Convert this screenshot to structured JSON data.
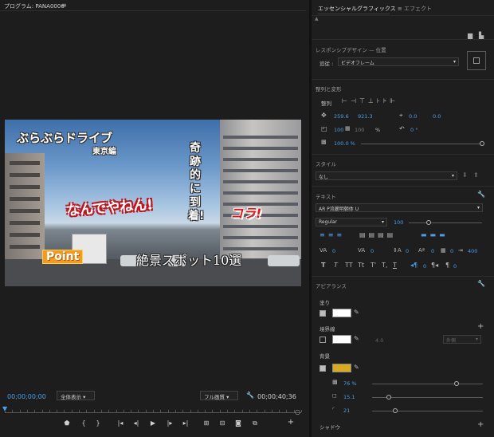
{
  "program": {
    "title": "プログラム: PANA0006",
    "menu_icon": "hamburger-menu-icon",
    "overlays": {
      "title1": "ぶらぶらドライブ",
      "title1_sub": "東京編",
      "shout": "なんでやねん!",
      "vertical": "奇跡的に到着!",
      "kora": "コラ!",
      "point": "Point",
      "spots": "絶景スポット10選"
    },
    "timecode_current": "00;00;00;00",
    "timecode_duration": "00;00;40;36",
    "zoom_select": "全体表示",
    "quality_select": "フル画質",
    "playhead_fraction": 0.0
  },
  "essential_graphics": {
    "tab_active": "エッセンシャルグラフィックス",
    "tab_other": "エフェクト",
    "responsive_design_label": "レスポンシブデザイン — 位置",
    "pin_label": "追従 :",
    "pin_value": "ビデオフレーム",
    "align_transform_label": "整列と変形",
    "align_label": "整列",
    "position_x": "259.6",
    "position_y": "921.3",
    "anchor_x": "0.0",
    "anchor_y": "0.0",
    "scale": "100",
    "scale_h": "100",
    "scale_unit": "%",
    "rotation": "0 °",
    "opacity": "100.0 %",
    "opacity_fraction": 1.0,
    "styles_label": "スタイル",
    "style_value": "なし",
    "text_label": "テキスト",
    "font_family": "AR P流麗明朝体 U",
    "font_style": "Regular",
    "font_size": "100",
    "font_size_fraction": 0.27,
    "tracking": "0",
    "kerning": "0",
    "leading": "0",
    "baseline": "0",
    "tsume": "0",
    "tab_width": "400",
    "caps_buttons": [
      "T",
      "T",
      "TT",
      "Tt",
      "T'",
      "T,",
      "T"
    ],
    "indent_value": "0",
    "indent_value2": "0",
    "appearance_label": "アピアランス",
    "fill_label": "塗り",
    "fill_color": "#ffffff",
    "stroke_label": "境界線",
    "stroke_color": "#ffffff",
    "stroke_width": "4.0",
    "stroke_position": "外側",
    "bg_label": "背景",
    "bg_color": "#d9a922",
    "bg_opacity": "76 %",
    "bg_opacity_fraction": 0.76,
    "bg_size": "15.1",
    "bg_size_fraction": 0.15,
    "bg_radius": "21",
    "bg_radius_fraction": 0.21,
    "shadow_label": "シャドウ"
  }
}
